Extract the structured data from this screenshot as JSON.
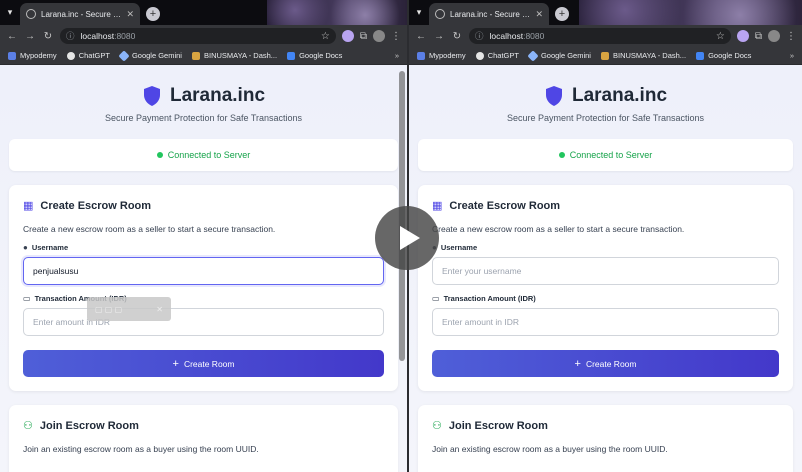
{
  "browser": {
    "tab_title": "Larana.inc - Secure Payment P...",
    "url_host": "localhost",
    "url_port": ":8080",
    "bookmarks": [
      "Mypodemy",
      "ChatGPT",
      "Google Gemini",
      "BINUSMAYA - Dash...",
      "Google Docs"
    ],
    "bookmarks_more": "»"
  },
  "app": {
    "brand_name": "Larana.inc",
    "tagline": "Secure Payment Protection for Safe Transactions",
    "status_text": "Connected to Server",
    "create_room": {
      "title": "Create Escrow Room",
      "description": "Create a new escrow room as a seller to start a secure transaction.",
      "username_label": "Username",
      "username_placeholder": "Enter your username",
      "username_value_left": "penjualsusu",
      "amount_label": "Transaction Amount (IDR)",
      "amount_placeholder": "Enter amount in IDR",
      "button_label": "Create Room"
    },
    "join_room": {
      "title": "Join Escrow Room",
      "description": "Join an existing escrow room as a buyer using the room UUID."
    }
  },
  "colors": {
    "accent": "#4f46e5",
    "status_green": "#16a34a",
    "button_start": "#4f5fd8",
    "button_end": "#4338ca"
  },
  "icons": {
    "shield": "shield-icon",
    "store": "store-icon",
    "user": "user-icon",
    "money": "money-icon",
    "users": "users-icon",
    "plus": "plus-icon",
    "play": "play-icon"
  }
}
